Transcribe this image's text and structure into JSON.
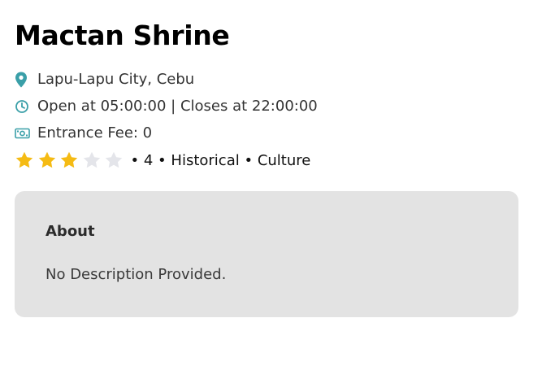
{
  "place": {
    "name": "Mactan Shrine",
    "location": "Lapu-Lapu City, Cebu",
    "hours": "Open at 05:00:00 | Closes at 22:00:00",
    "fee": "Entrance Fee: 0"
  },
  "rating": {
    "value": 3,
    "max": 5,
    "separator": "•",
    "count": "4",
    "categories": [
      "Historical",
      "Culture"
    ],
    "filled_color": "#f5bb14",
    "empty_color": "#e4e5ea"
  },
  "about": {
    "heading": "About",
    "description": "No Description Provided."
  },
  "colors": {
    "icon_accent": "#3a9fa8",
    "card_background": "#e3e3e3"
  },
  "icons": {
    "location": "map-pin-icon",
    "hours": "clock-icon",
    "fee": "money-icon",
    "star": "star-icon"
  }
}
